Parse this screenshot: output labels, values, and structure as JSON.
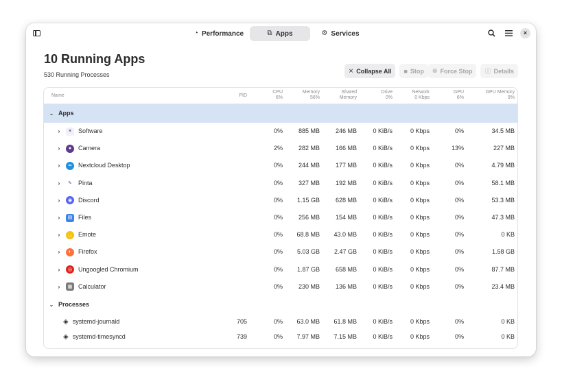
{
  "header": {
    "tabs": [
      {
        "label": "Performance",
        "icon": "gauge-icon",
        "glyph": "◔"
      },
      {
        "label": "Apps",
        "icon": "apps-icon",
        "glyph": "⧉",
        "active": true
      },
      {
        "label": "Services",
        "icon": "services-icon",
        "glyph": "⚙"
      }
    ],
    "search_glyph": "🔍",
    "menu_glyph": "☰",
    "close_glyph": "×"
  },
  "title": "10 Running Apps",
  "subtitle": "530 Running Processes",
  "actions": {
    "collapse": {
      "label": "Collapse All",
      "glyph": "⨯"
    },
    "stop": {
      "label": "Stop",
      "glyph": "■"
    },
    "force_stop": {
      "label": "Force Stop",
      "glyph": "⊗"
    },
    "details": {
      "label": "Details",
      "glyph": "ⓘ"
    }
  },
  "columns": {
    "name": "Name",
    "pid": "PID",
    "cpu": {
      "label": "CPU",
      "sub": "6%"
    },
    "memory": {
      "label": "Memory",
      "sub": "56%"
    },
    "shared": {
      "label": "Shared",
      "sub": "Memory"
    },
    "drive": {
      "label": "Drive",
      "sub": "0%"
    },
    "network": {
      "label": "Network",
      "sub": "0 Kbps"
    },
    "gpu": {
      "label": "GPU",
      "sub": "6%"
    },
    "gpu_memory": {
      "label": "GPU Memory",
      "sub": "9%"
    }
  },
  "groups": {
    "apps": {
      "label": "Apps",
      "chevron": "⌄"
    },
    "processes": {
      "label": "Processes",
      "chevron": "⌄"
    }
  },
  "apps": [
    {
      "name": "Software",
      "cpu": "0%",
      "memory": "885 MB",
      "shared": "246 MB",
      "drive": "0 KiB/s",
      "network": "0 Kbps",
      "gpu": "0%",
      "gpu_memory": "34.5 MB",
      "icon_color": "#f2f2f4",
      "icon_glyph": "✶"
    },
    {
      "name": "Camera",
      "cpu": "2%",
      "memory": "282 MB",
      "shared": "166 MB",
      "drive": "0 KiB/s",
      "network": "0 Kbps",
      "gpu": "13%",
      "gpu_memory": "227 MB",
      "icon_color": "#5b3b8c",
      "icon_glyph": "●"
    },
    {
      "name": "Nextcloud Desktop",
      "cpu": "0%",
      "memory": "244 MB",
      "shared": "177 MB",
      "drive": "0 KiB/s",
      "network": "0 Kbps",
      "gpu": "0%",
      "gpu_memory": "4.79 MB",
      "icon_color": "#1e91e0",
      "icon_glyph": "∞"
    },
    {
      "name": "Pinta",
      "cpu": "0%",
      "memory": "327 MB",
      "shared": "192 MB",
      "drive": "0 KiB/s",
      "network": "0 Kbps",
      "gpu": "0%",
      "gpu_memory": "58.1 MB",
      "icon_color": "#ffffff",
      "icon_glyph": "✎"
    },
    {
      "name": "Discord",
      "cpu": "0%",
      "memory": "1.15 GB",
      "shared": "628 MB",
      "drive": "0 KiB/s",
      "network": "0 Kbps",
      "gpu": "0%",
      "gpu_memory": "53.3 MB",
      "icon_color": "#5865f2",
      "icon_glyph": "◉"
    },
    {
      "name": "Files",
      "cpu": "0%",
      "memory": "256 MB",
      "shared": "154 MB",
      "drive": "0 KiB/s",
      "network": "0 Kbps",
      "gpu": "0%",
      "gpu_memory": "47.3 MB",
      "icon_color": "#3c84e6",
      "icon_glyph": "▤"
    },
    {
      "name": "Emote",
      "cpu": "0%",
      "memory": "68.8 MB",
      "shared": "43.0 MB",
      "drive": "0 KiB/s",
      "network": "0 Kbps",
      "gpu": "0%",
      "gpu_memory": "0 KB",
      "icon_color": "#f5c211",
      "icon_glyph": "◡"
    },
    {
      "name": "Firefox",
      "cpu": "0%",
      "memory": "5.03 GB",
      "shared": "2.47 GB",
      "drive": "0 KiB/s",
      "network": "0 Kbps",
      "gpu": "0%",
      "gpu_memory": "1.58 GB",
      "icon_color": "#ff7139",
      "icon_glyph": "◐"
    },
    {
      "name": "Ungoogled Chromium",
      "cpu": "0%",
      "memory": "1.87 GB",
      "shared": "658 MB",
      "drive": "0 KiB/s",
      "network": "0 Kbps",
      "gpu": "0%",
      "gpu_memory": "87.7 MB",
      "icon_color": "#e0201b",
      "icon_glyph": "◎"
    },
    {
      "name": "Calculator",
      "cpu": "0%",
      "memory": "230 MB",
      "shared": "136 MB",
      "drive": "0 KiB/s",
      "network": "0 Kbps",
      "gpu": "0%",
      "gpu_memory": "23.4 MB",
      "icon_color": "#7a7a7a",
      "icon_glyph": "▦"
    }
  ],
  "processes": [
    {
      "name": "systemd-journald",
      "pid": "705",
      "cpu": "0%",
      "memory": "63.0 MB",
      "shared": "61.8 MB",
      "drive": "0 KiB/s",
      "network": "0 Kbps",
      "gpu": "0%",
      "gpu_memory": "0 KB",
      "icon_glyph": "◈"
    },
    {
      "name": "systemd-timesyncd",
      "pid": "739",
      "cpu": "0%",
      "memory": "7.97 MB",
      "shared": "7.15 MB",
      "drive": "0 KiB/s",
      "network": "0 Kbps",
      "gpu": "0%",
      "gpu_memory": "0 KB",
      "icon_glyph": "◈"
    }
  ],
  "row_chevron": "›"
}
